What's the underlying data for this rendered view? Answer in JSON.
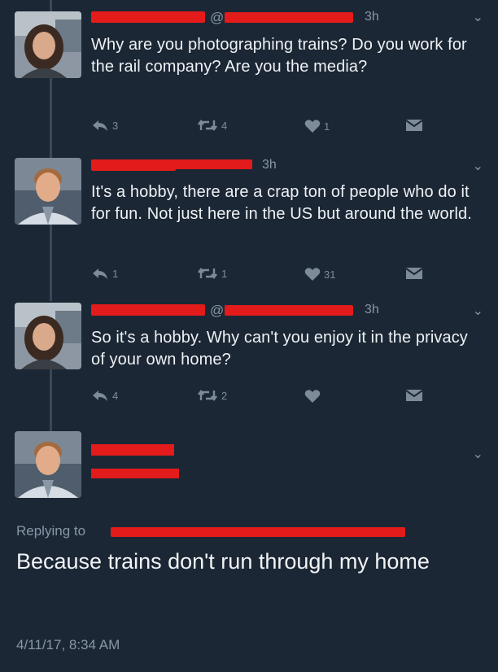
{
  "colors": {
    "background": "#1c2735",
    "redaction": "#e31b1b",
    "secondary_text": "#8796a6",
    "primary_text": "#eef1f4"
  },
  "tweets": [
    {
      "handle_prefix": "@",
      "time": "3h",
      "text": "Why are you photographing trains? Do you work for the rail company? Are you the media?",
      "reply_count": "3",
      "retweet_count": "4",
      "like_count": "1"
    },
    {
      "handle_prefix": "@",
      "time": "3h",
      "text": "It's a hobby, there are a crap ton of people who do it for fun. Not just here in the US but around the world.",
      "reply_count": "1",
      "retweet_count": "1",
      "like_count": "31"
    },
    {
      "handle_prefix": "@",
      "time": "3h",
      "text": "So it's a hobby. Why can't you enjoy it in the privacy of your own home?",
      "reply_count": "4",
      "retweet_count": "2",
      "like_count": ""
    }
  ],
  "focus_tweet": {
    "replying_label": "Replying to",
    "text": "Because trains don't run through my home",
    "timestamp": "4/11/17, 8:34 AM"
  },
  "icons": {
    "reply": "reply-icon",
    "retweet": "retweet-icon",
    "like": "heart-icon",
    "dm": "envelope-icon",
    "more": "chevron-down-icon"
  }
}
